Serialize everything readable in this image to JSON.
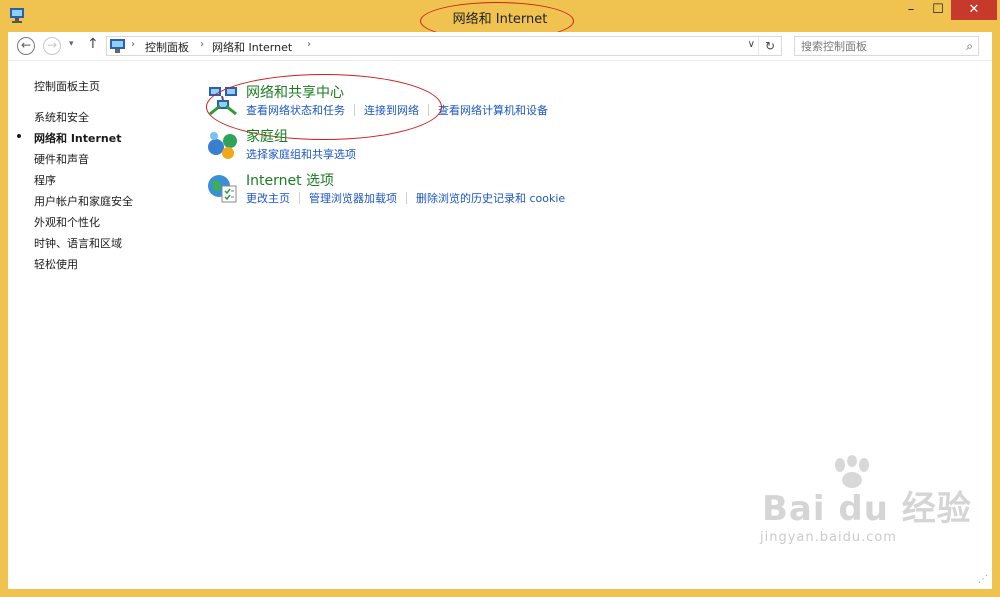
{
  "window": {
    "title": "网络和 Internet",
    "minimize_symbol": "–",
    "maximize_symbol": "☐",
    "close_symbol": "✕",
    "frame_color": "#f0c350",
    "close_color": "#c7392b"
  },
  "navigation": {
    "back_symbol": "←",
    "forward_symbol": "→",
    "recent_symbol": "▾",
    "up_symbol": "↑",
    "breadcrumbs": [
      "控制面板",
      "网络和 Internet"
    ],
    "separator": "›",
    "dropdown_symbol": "∨",
    "refresh_symbol": "↻"
  },
  "search": {
    "placeholder": "搜索控制面板",
    "icon_symbol": "⌕"
  },
  "sidebar": {
    "home": "控制面板主页",
    "items": [
      {
        "label": "系统和安全",
        "active": false
      },
      {
        "label": "网络和 Internet",
        "active": true
      },
      {
        "label": "硬件和声音",
        "active": false
      },
      {
        "label": "程序",
        "active": false
      },
      {
        "label": "用户帐户和家庭安全",
        "active": false
      },
      {
        "label": "外观和个性化",
        "active": false
      },
      {
        "label": "时钟、语言和区域",
        "active": false
      },
      {
        "label": "轻松使用",
        "active": false
      }
    ]
  },
  "categories": [
    {
      "title": "网络和共享中心",
      "icon": "network-sharing-center-icon",
      "links": [
        "查看网络状态和任务",
        "连接到网络",
        "查看网络计算机和设备"
      ]
    },
    {
      "title": "家庭组",
      "icon": "homegroup-icon",
      "links": [
        "选择家庭组和共享选项"
      ]
    },
    {
      "title": "Internet 选项",
      "icon": "internet-options-icon",
      "links": [
        "更改主页",
        "管理浏览器加载项",
        "删除浏览的历史记录和 cookie"
      ]
    }
  ],
  "colors": {
    "category_title": "#1a7e20",
    "link": "#1b56c4",
    "annotation": "#d21b1b"
  },
  "watermark": {
    "logo": "Bai du 经验",
    "url": "jingyan.baidu.com"
  }
}
